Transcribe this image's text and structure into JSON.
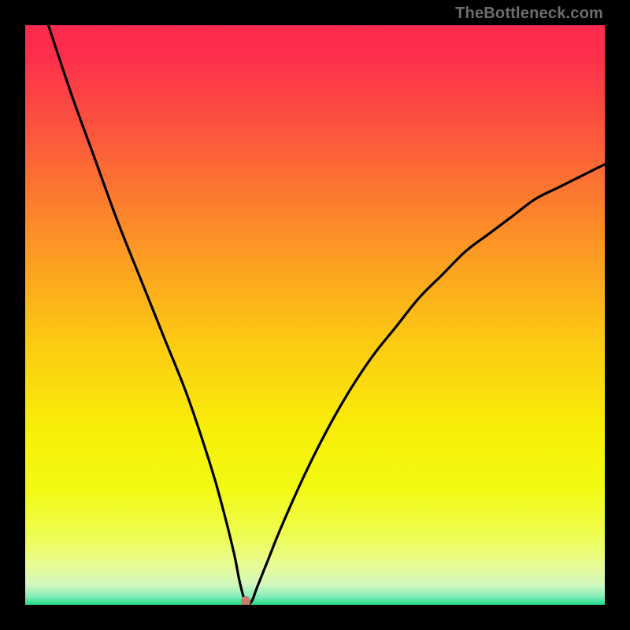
{
  "watermark": "TheBottleneck.com",
  "chart_data": {
    "type": "line",
    "title": "",
    "xlabel": "",
    "ylabel": "",
    "xlim": [
      0,
      100
    ],
    "ylim": [
      0,
      100
    ],
    "grid": false,
    "legend": false,
    "annotations": [],
    "series": [
      {
        "name": "curve",
        "x": [
          4,
          8,
          12,
          16,
          20,
          24,
          28,
          32,
          34,
          36,
          37,
          38,
          39,
          40,
          42,
          44,
          48,
          52,
          56,
          60,
          64,
          68,
          72,
          76,
          80,
          84,
          88,
          92,
          96,
          100
        ],
        "y": [
          100,
          88,
          77,
          66,
          56,
          46,
          36,
          24,
          17,
          9,
          4,
          0.5,
          0.5,
          3,
          8,
          13,
          22,
          30,
          37,
          43,
          48,
          53,
          57,
          61,
          64,
          67,
          70,
          72,
          74,
          76
        ]
      }
    ],
    "marker": {
      "x": 38,
      "y": 0.5,
      "color": "#c97b6e"
    },
    "gradient_stops_vertical": [
      {
        "offset": 0.0,
        "color": "#fd2a4e"
      },
      {
        "offset": 0.05,
        "color": "#fd2e4c"
      },
      {
        "offset": 0.2,
        "color": "#fc5b3b"
      },
      {
        "offset": 0.4,
        "color": "#fc9c23"
      },
      {
        "offset": 0.55,
        "color": "#fccb12"
      },
      {
        "offset": 0.7,
        "color": "#f8ef08"
      },
      {
        "offset": 0.8,
        "color": "#f2fa14"
      },
      {
        "offset": 0.88,
        "color": "#effd52"
      },
      {
        "offset": 0.93,
        "color": "#e9fc92"
      },
      {
        "offset": 0.965,
        "color": "#d3f8be"
      },
      {
        "offset": 0.985,
        "color": "#88edbb"
      },
      {
        "offset": 1.0,
        "color": "#20de8b"
      }
    ]
  }
}
